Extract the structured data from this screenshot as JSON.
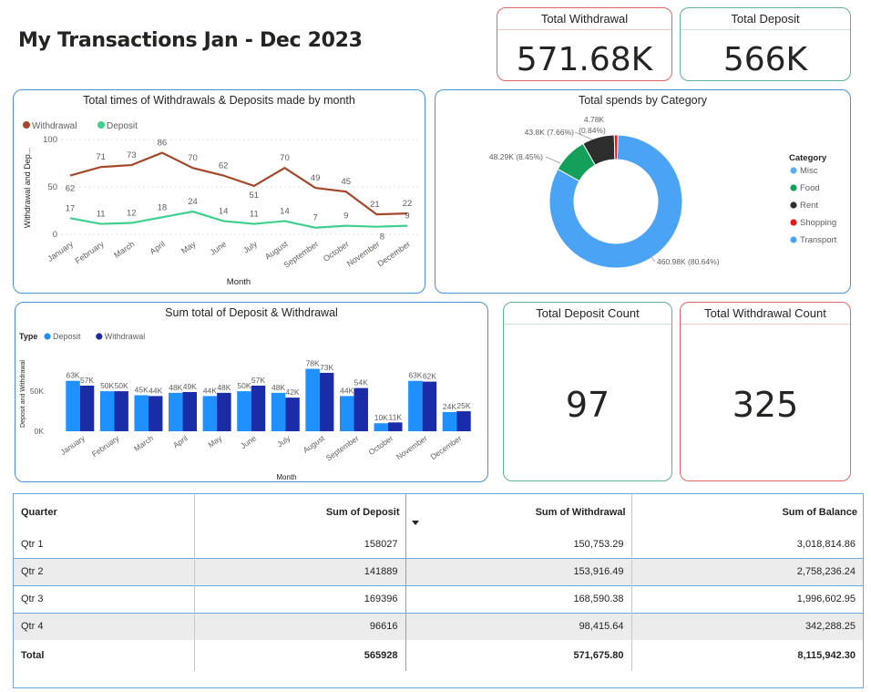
{
  "page": {
    "title": "My Transactions Jan - Dec 2023"
  },
  "kpis": {
    "total_withdrawal": {
      "label": "Total Withdrawal",
      "value": "571.68K"
    },
    "total_deposit": {
      "label": "Total Deposit",
      "value": "566K"
    },
    "deposit_count": {
      "label": "Total Deposit Count",
      "value": "97"
    },
    "withdrawal_count": {
      "label": "Total Withdrawal Count",
      "value": "325"
    }
  },
  "colors": {
    "withdrawal_line": "#a5472a",
    "deposit_line": "#3fcf8e",
    "deposit_bar": "#1e90ff",
    "withdrawal_bar": "#1a2ca8"
  },
  "chart_data": [
    {
      "type": "line",
      "title": "Total times of Withdrawals & Deposits made by month",
      "xlabel": "Month",
      "ylabel": "Withdrawal and Dep...",
      "categories": [
        "January",
        "February",
        "March",
        "April",
        "May",
        "June",
        "July",
        "August",
        "September",
        "October",
        "November",
        "December"
      ],
      "yticks": [
        "100",
        "50",
        "0"
      ],
      "ylim": [
        0,
        100
      ],
      "legend_position": "top-left",
      "series": [
        {
          "name": "Withdrawal",
          "color": "#a5472a",
          "values": [
            62,
            71,
            73,
            86,
            70,
            62,
            51,
            70,
            49,
            45,
            21,
            22
          ]
        },
        {
          "name": "Deposit",
          "color": "#3fcf8e",
          "values": [
            17,
            11,
            12,
            18,
            24,
            14,
            11,
            14,
            7,
            9,
            8,
            9
          ]
        }
      ]
    },
    {
      "type": "pie",
      "title": "Total spends by Category",
      "legend_title": "Category",
      "legend_position": "right",
      "slices": [
        {
          "name": "Misc",
          "value": 0,
          "color": "#5aaeea",
          "label": ""
        },
        {
          "name": "Food",
          "value": 48.29,
          "color": "#14a05a",
          "label": "48.29K (8.45%)"
        },
        {
          "name": "Rent",
          "value": 43.8,
          "color": "#2e2e2e",
          "label": "43.8K (7.66%)"
        },
        {
          "name": "Shopping",
          "value": 4.78,
          "color": "#e01b1b",
          "label": "4.78K (0.84%)"
        },
        {
          "name": "Transport",
          "value": 460.98,
          "color": "#4aa3f5",
          "label": "460.98K (80.64%)"
        }
      ]
    },
    {
      "type": "bar",
      "title": "Sum total of Deposit & Withdrawal",
      "legend_title": "Type",
      "legend_position": "top-left",
      "xlabel": "Month",
      "ylabel": "Deposit and Withdrawal",
      "categories": [
        "January",
        "February",
        "March",
        "April",
        "May",
        "June",
        "July",
        "August",
        "September",
        "October",
        "November",
        "December"
      ],
      "yticks": [
        "50K",
        "0K"
      ],
      "ylim": [
        0,
        90
      ],
      "series": [
        {
          "name": "Deposit",
          "color": "#1e90ff",
          "values": [
            63,
            50,
            45,
            48,
            44,
            50,
            48,
            78,
            44,
            10,
            63,
            24
          ],
          "labels": [
            "63K",
            "50K",
            "45K",
            "48K",
            "44K",
            "50K",
            "48K",
            "78K",
            "44K",
            "10K",
            "63K",
            "24K"
          ]
        },
        {
          "name": "Withdrawal",
          "color": "#1a2ca8",
          "values": [
            57,
            50,
            44,
            49,
            48,
            57,
            42,
            73,
            54,
            11,
            62,
            25
          ],
          "labels": [
            "57K",
            "50K",
            "44K",
            "49K",
            "48K",
            "57K",
            "42K",
            "73K",
            "54K",
            "11K",
            "62K",
            "25K"
          ]
        }
      ]
    }
  ],
  "table": {
    "headers": {
      "quarter": "Quarter",
      "deposit": "Sum of Deposit",
      "withdrawal": "Sum of Withdrawal",
      "balance": "Sum of Balance"
    },
    "rows": [
      {
        "quarter": "Qtr 1",
        "deposit": "158027",
        "withdrawal": "150,753.29",
        "balance": "3,018,814.86"
      },
      {
        "quarter": "Qtr 2",
        "deposit": "141889",
        "withdrawal": "153,916.49",
        "balance": "2,758,236.24"
      },
      {
        "quarter": "Qtr 3",
        "deposit": "169396",
        "withdrawal": "168,590.38",
        "balance": "1,996,602.95"
      },
      {
        "quarter": "Qtr 4",
        "deposit": "96616",
        "withdrawal": "98,415.64",
        "balance": "342,288.25"
      }
    ],
    "total": {
      "quarter": "Total",
      "deposit": "565928",
      "withdrawal": "571,675.80",
      "balance": "8,115,942.30"
    }
  }
}
